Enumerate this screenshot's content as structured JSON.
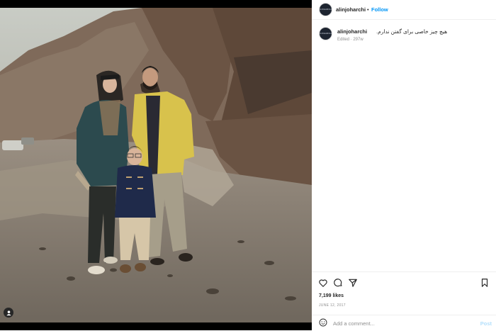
{
  "header": {
    "username": "alinjoharchi",
    "separator": "•",
    "follow_label": "Follow",
    "more_label": "···"
  },
  "avatar": {
    "text": "NJOHARCHI"
  },
  "caption": {
    "username": "alinjoharchi",
    "text": ".هیچ چیز خاصی برای گفتن ندارم",
    "meta": "Edited · 297w"
  },
  "actions": {
    "like_icon": "heart-icon",
    "comment_icon": "comment-icon",
    "share_icon": "share-icon",
    "save_icon": "bookmark-icon"
  },
  "likes": "7,199 likes",
  "date": "JUNE 12, 2017",
  "comment": {
    "placeholder": "Add a comment...",
    "post_label": "Post"
  },
  "colors": {
    "accent": "#0095f6",
    "post_disabled": "#b2dffc",
    "text": "#262626",
    "muted": "#8e8e8e"
  }
}
